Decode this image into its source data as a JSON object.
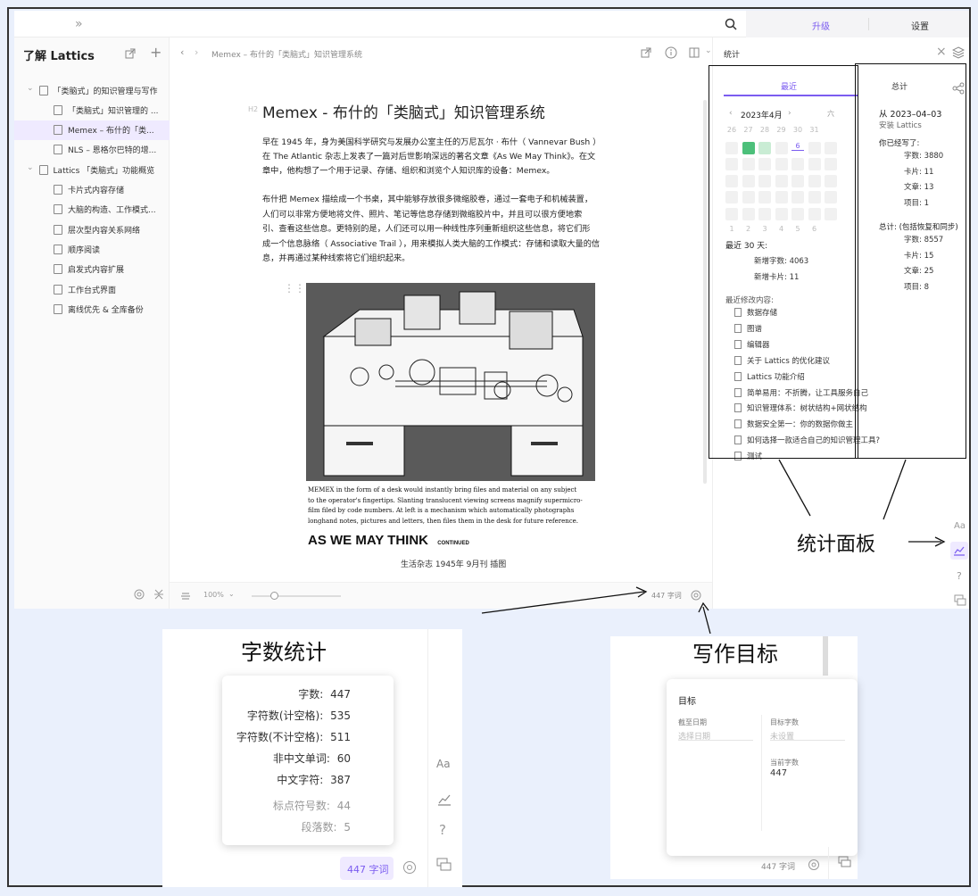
{
  "topbar": {
    "expand_icon": "»",
    "search_icon": "search",
    "upgrade": "升级",
    "settings": "设置"
  },
  "sidebar": {
    "title": "了解 Lattics",
    "items": [
      {
        "label": "「类脑式」的知识管理与写作",
        "level": 0
      },
      {
        "label": "「类脑式」知识管理的 ...",
        "level": 1
      },
      {
        "label": "Memex – 布什的「类...",
        "level": 1
      },
      {
        "label": "NLS – 恩格尔巴特的增...",
        "level": 1
      },
      {
        "label": "Lattics 「类脑式」功能概览",
        "level": 0
      },
      {
        "label": "卡片式内容存储",
        "level": 1
      },
      {
        "label": "大脑的构造、工作模式...",
        "level": 1
      },
      {
        "label": "层次型内容关系网络",
        "level": 1
      },
      {
        "label": "顺序阅读",
        "level": 1
      },
      {
        "label": "启发式内容扩展",
        "level": 1
      },
      {
        "label": "工作台式界面",
        "level": 1
      },
      {
        "label": "离线优先 & 全库备份",
        "level": 1
      }
    ]
  },
  "editor": {
    "breadcrumb": "Memex – 布什的「类脑式」知识管理系统",
    "heading_tag": "H2",
    "title": "Memex - 布什的「类脑式」知识管理系统",
    "para1_lines": [
      "早在 1945 年，身为美国科学研究与发展办公室主任的万尼瓦尔 · 布什（ Vannevar Bush ）",
      "在 The Atlantic 杂志上发表了一篇对后世影响深远的著名文章《As We May Think》。在文",
      "章中，他构想了一个用于记录、存储、组织和浏览个人知识库的设备：Memex。"
    ],
    "para2_lines": [
      "布什把 Memex 描绘成一个书桌，其中能够存放很多微缩胶卷，通过一套电子和机械装置，",
      "人们可以非常方便地将文件、照片、笔记等信息存储到微缩胶片中，并且可以很方便地索",
      "引、查看这些信息。更特别的是，人们还可以用一种线性序列重新组织这些信息，将它们形",
      "成一个信息脉络（ Associative Trail ），用来模拟人类大脑的工作模式：存储和读取大量的信",
      "息，并再通过某种线索将它们组织起来。"
    ],
    "image_caption_lines": [
      "MEMEX in the form of a desk would instantly bring files and material on any subject",
      "to the operator's fingertips. Slanting translucent viewing screens magnify supermicro-",
      "film filed by code numbers. At left is a mechanism which automatically photographs",
      "longhand notes, pictures and letters, then files them in the desk for future reference."
    ],
    "image_title": "AS WE MAY THINK",
    "image_title_small": "CONTINUED",
    "image_credit": "生活杂志 1945年 9月刊 插图",
    "zoom": "100%",
    "zoom_level": 0.25,
    "word_count": "447 字词"
  },
  "stats_panel": {
    "title": "统计",
    "tab_recent": "最近",
    "tab_total": "总计",
    "month": "2023年4月",
    "weekday_last": "六",
    "week1": [
      "26",
      "27",
      "28",
      "29",
      "30",
      "31"
    ],
    "today": "6",
    "last_row": [
      "1",
      "2",
      "3",
      "4",
      "5",
      "6"
    ],
    "last30_label": "最近 30 天:",
    "new_words": "新增字数: 4063",
    "new_cards": "新增卡片: 11",
    "recent_label": "最近修改内容:",
    "recent_items": [
      "数据存储",
      "图谱",
      "编辑器",
      "关于 Lattics 的优化建议",
      "Lattics 功能介绍",
      "简单易用：不折腾，让工具服务自己",
      "知识管理体系：树状结构+网状结构",
      "数据安全第一：你的数据你做主",
      "如何选择一款适合自己的知识管理工具?",
      "测试"
    ],
    "since": "从 2023–04–03",
    "installed": "安装 Lattics",
    "written_label": "你已经写了:",
    "written": [
      "字数: 3880",
      "卡片: 11",
      "文章: 13",
      "项目: 1"
    ],
    "total_label": "总计: (包括恢复和同步)",
    "total": [
      "字数: 8557",
      "卡片: 15",
      "文章: 25",
      "项目: 8"
    ]
  },
  "right_toolbar": {
    "font_label": "Aa",
    "help": "?"
  },
  "annotations": {
    "stats_panel": "统计面板",
    "word_stats": "字数统计",
    "writing_goal": "写作目标"
  },
  "word_popup": {
    "rows": [
      {
        "label": "字数:",
        "value": "447"
      },
      {
        "label": "字符数(计空格):",
        "value": "535"
      },
      {
        "label": "字符数(不计空格):",
        "value": "511"
      },
      {
        "label": "非中文单词:",
        "value": "60"
      },
      {
        "label": "中文字符:",
        "value": "387"
      },
      {
        "label": "标点符号数:",
        "value": "44"
      },
      {
        "label": "段落数:",
        "value": "5"
      }
    ],
    "badge": "447 字词",
    "side_font": "Aa",
    "side_help": "?"
  },
  "goal_popup": {
    "title": "目标",
    "deadline_label": "截至日期",
    "deadline_placeholder": "选择日期",
    "target_label": "目标字数",
    "target_placeholder": "未设置",
    "current_label": "当前字数",
    "current_value": "447",
    "badge": "447 字词"
  },
  "colors": {
    "accent": "#7b5cf0",
    "link": "#2f6fdf",
    "calendar_active": "#4cc07a",
    "calendar_light": "#c9ecd4"
  }
}
